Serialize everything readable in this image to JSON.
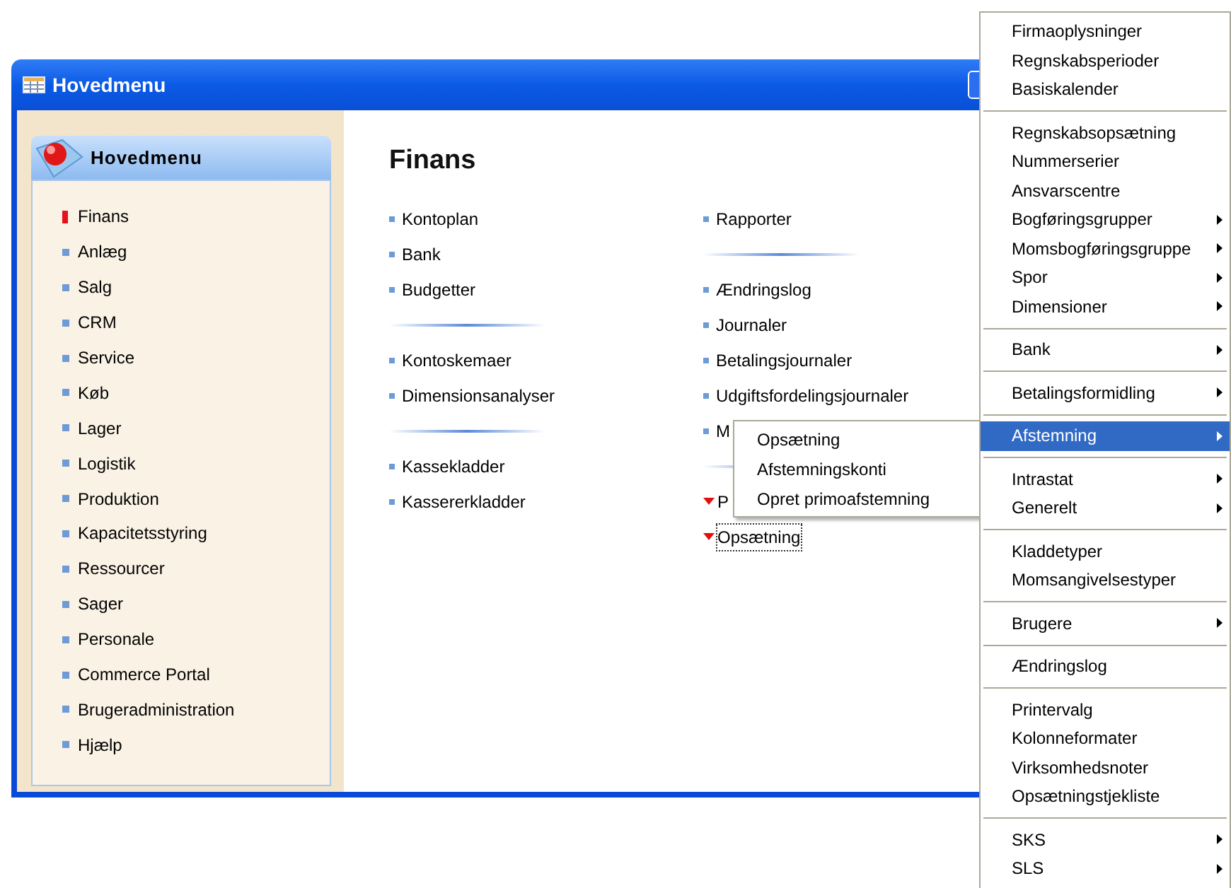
{
  "window": {
    "title": "Hovedmenu"
  },
  "sidebar": {
    "title": "Hovedmenu",
    "items": [
      {
        "label": "Finans",
        "selected": true
      },
      {
        "label": "Anlæg",
        "selected": false
      },
      {
        "label": "Salg",
        "selected": false
      },
      {
        "label": "CRM",
        "selected": false
      },
      {
        "label": "Service",
        "selected": false
      },
      {
        "label": "Køb",
        "selected": false
      },
      {
        "label": "Lager",
        "selected": false
      },
      {
        "label": "Logistik",
        "selected": false
      },
      {
        "label": "Produktion",
        "selected": false
      },
      {
        "label": "Kapacitetsstyring",
        "selected": false
      },
      {
        "label": "Ressourcer",
        "selected": false
      },
      {
        "label": "Sager",
        "selected": false
      },
      {
        "label": "Personale",
        "selected": false
      },
      {
        "label": "Commerce Portal",
        "selected": false
      },
      {
        "label": "Brugeradministration",
        "selected": false
      },
      {
        "label": "Hjælp",
        "selected": false
      }
    ]
  },
  "content": {
    "heading": "Finans",
    "columns": [
      {
        "items": [
          {
            "kind": "link",
            "label": "Kontoplan"
          },
          {
            "kind": "link",
            "label": "Bank"
          },
          {
            "kind": "link",
            "label": "Budgetter"
          },
          {
            "kind": "separator"
          },
          {
            "kind": "link",
            "label": "Kontoskemaer"
          },
          {
            "kind": "link",
            "label": "Dimensionsanalyser"
          },
          {
            "kind": "separator"
          },
          {
            "kind": "link",
            "label": "Kassekladder"
          },
          {
            "kind": "link",
            "label": "Kassererkladder"
          }
        ]
      },
      {
        "items": [
          {
            "kind": "link",
            "label": "Rapporter"
          },
          {
            "kind": "separator"
          },
          {
            "kind": "link",
            "label": "Ændringslog"
          },
          {
            "kind": "link",
            "label": "Journaler"
          },
          {
            "kind": "link",
            "label": "Betalingsjournaler"
          },
          {
            "kind": "link",
            "label": "Udgiftsfordelingsjournaler"
          },
          {
            "kind": "link",
            "label": "M"
          },
          {
            "kind": "separator"
          },
          {
            "kind": "group",
            "label": "P",
            "focused": false
          },
          {
            "kind": "group",
            "label": "Opsætning",
            "focused": true
          }
        ]
      }
    ]
  },
  "submenu": {
    "items": [
      "Opsætning",
      "Afstemningskonti",
      "Opret primoafstemning"
    ]
  },
  "context_menu": {
    "items": [
      {
        "kind": "item",
        "label": "Firmaoplysninger",
        "submenu": false,
        "selected": false
      },
      {
        "kind": "item",
        "label": "Regnskabsperioder",
        "submenu": false,
        "selected": false
      },
      {
        "kind": "item",
        "label": "Basiskalender",
        "submenu": false,
        "selected": false
      },
      {
        "kind": "separator"
      },
      {
        "kind": "item",
        "label": "Regnskabsopsætning",
        "submenu": false,
        "selected": false
      },
      {
        "kind": "item",
        "label": "Nummerserier",
        "submenu": false,
        "selected": false
      },
      {
        "kind": "item",
        "label": "Ansvarscentre",
        "submenu": false,
        "selected": false
      },
      {
        "kind": "item",
        "label": "Bogføringsgrupper",
        "submenu": true,
        "selected": false
      },
      {
        "kind": "item",
        "label": "Momsbogføringsgruppe",
        "submenu": true,
        "selected": false
      },
      {
        "kind": "item",
        "label": "Spor",
        "submenu": true,
        "selected": false
      },
      {
        "kind": "item",
        "label": "Dimensioner",
        "submenu": true,
        "selected": false
      },
      {
        "kind": "separator"
      },
      {
        "kind": "item",
        "label": "Bank",
        "submenu": true,
        "selected": false
      },
      {
        "kind": "separator"
      },
      {
        "kind": "item",
        "label": "Betalingsformidling",
        "submenu": true,
        "selected": false
      },
      {
        "kind": "separator"
      },
      {
        "kind": "item",
        "label": "Afstemning",
        "submenu": true,
        "selected": true
      },
      {
        "kind": "separator"
      },
      {
        "kind": "item",
        "label": "Intrastat",
        "submenu": true,
        "selected": false
      },
      {
        "kind": "item",
        "label": "Generelt",
        "submenu": true,
        "selected": false
      },
      {
        "kind": "separator"
      },
      {
        "kind": "item",
        "label": "Kladdetyper",
        "submenu": false,
        "selected": false
      },
      {
        "kind": "item",
        "label": "Momsangivelsestyper",
        "submenu": false,
        "selected": false
      },
      {
        "kind": "separator"
      },
      {
        "kind": "item",
        "label": "Brugere",
        "submenu": true,
        "selected": false
      },
      {
        "kind": "separator"
      },
      {
        "kind": "item",
        "label": "Ændringslog",
        "submenu": false,
        "selected": false
      },
      {
        "kind": "separator"
      },
      {
        "kind": "item",
        "label": "Printervalg",
        "submenu": false,
        "selected": false
      },
      {
        "kind": "item",
        "label": "Kolonneformater",
        "submenu": false,
        "selected": false
      },
      {
        "kind": "item",
        "label": "Virksomhedsnoter",
        "submenu": false,
        "selected": false
      },
      {
        "kind": "item",
        "label": "Opsætningstjekliste",
        "submenu": false,
        "selected": false
      },
      {
        "kind": "separator"
      },
      {
        "kind": "item",
        "label": "SKS",
        "submenu": true,
        "selected": false
      },
      {
        "kind": "item",
        "label": "SLS",
        "submenu": true,
        "selected": false
      }
    ]
  }
}
